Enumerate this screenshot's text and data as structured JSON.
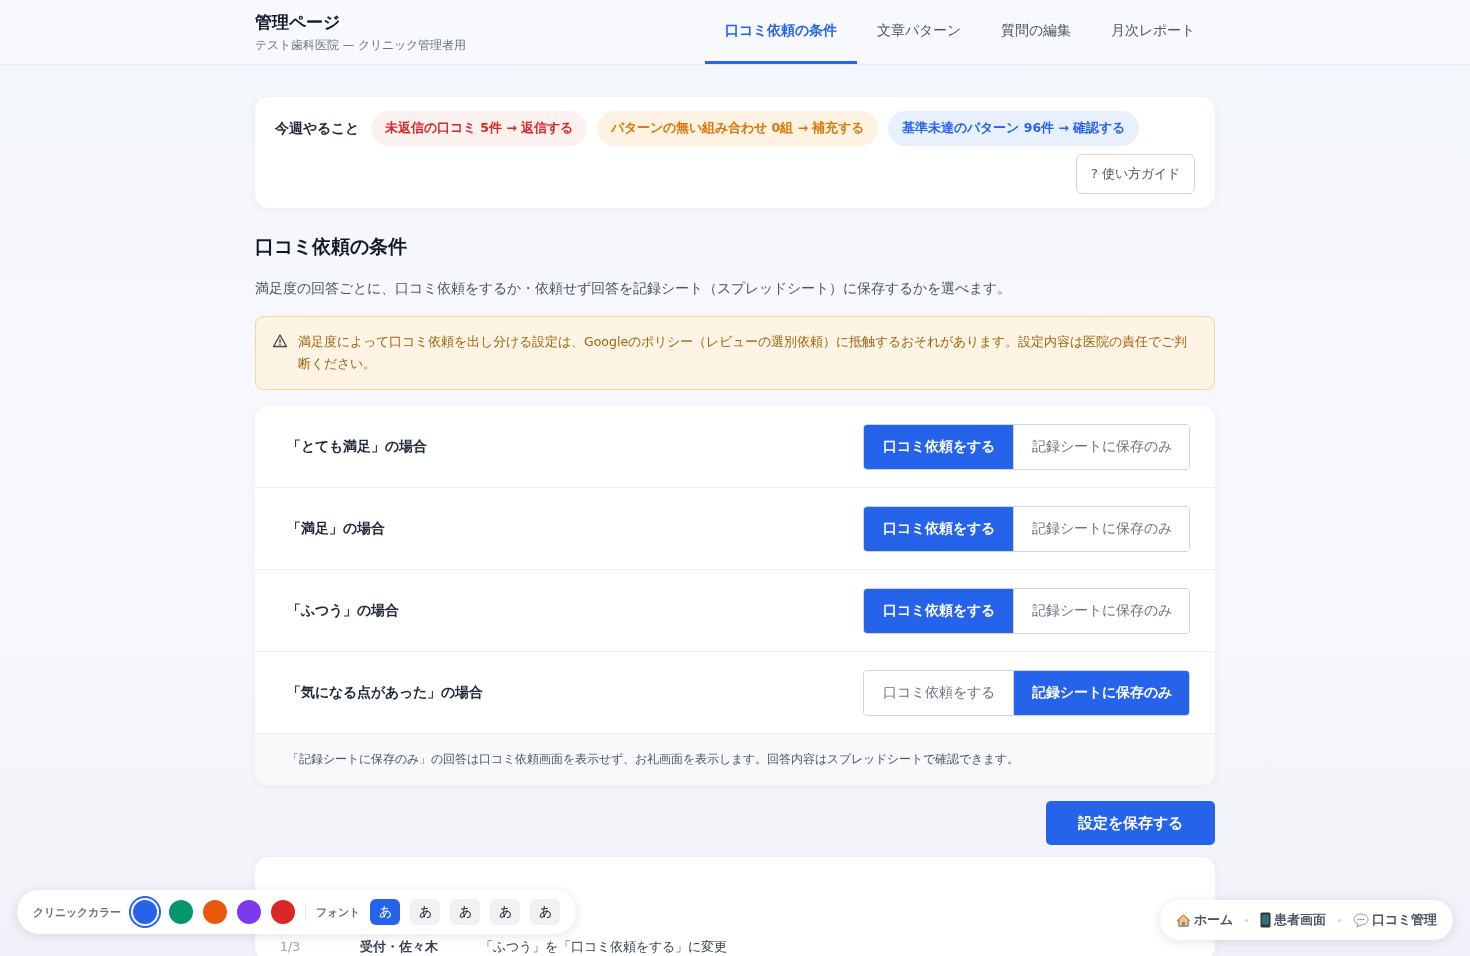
{
  "header": {
    "title": "管理ページ",
    "subtitle": "テスト歯科医院 — クリニック管理者用",
    "tabs": [
      {
        "label": "口コミ依頼の条件",
        "selected": true
      },
      {
        "label": "文章パターン",
        "selected": false
      },
      {
        "label": "質問の編集",
        "selected": false
      },
      {
        "label": "月次レポート",
        "selected": false
      }
    ]
  },
  "todo": {
    "label": "今週やること",
    "chips": [
      {
        "label": "未返信の口コミ 5件 → 返信する",
        "kind": "danger"
      },
      {
        "label": "パターンの無い組み合わせ 0組 → 補充する",
        "kind": "warning"
      },
      {
        "label": "基準未達のパターン 96件 → 確認する",
        "kind": "info"
      }
    ],
    "guide_button": "? 使い方ガイド"
  },
  "section": {
    "title": "口コミ依頼の条件",
    "description": "満足度の回答ごとに、口コミ依頼をするか・依頼せず回答を記録シート（スプレッドシート）に保存するかを選べます。",
    "warning": "満足度によって口コミ依頼を出し分ける設定は、Googleのポリシー（レビューの選別依頼）に抵触するおそれがあります。設定内容は医院の責任でご判断ください。"
  },
  "conditions": [
    {
      "label": "「とても満足」の場合",
      "options": [
        {
          "label": "口コミ依頼をする",
          "selected": true
        },
        {
          "label": "記録シートに保存のみ",
          "selected": false
        }
      ]
    },
    {
      "label": "「満足」の場合",
      "options": [
        {
          "label": "口コミ依頼をする",
          "selected": true
        },
        {
          "label": "記録シートに保存のみ",
          "selected": false
        }
      ]
    },
    {
      "label": "「ふつう」の場合",
      "options": [
        {
          "label": "口コミ依頼をする",
          "selected": true
        },
        {
          "label": "記録シートに保存のみ",
          "selected": false
        }
      ]
    },
    {
      "label": "「気になる点があった」の場合",
      "options": [
        {
          "label": "口コミ依頼をする",
          "selected": false
        },
        {
          "label": "記録シートに保存のみ",
          "selected": true
        }
      ]
    }
  ],
  "conditions_note": "「記録シートに保存のみ」の回答は口コミ依頼画面を表示せず、お礼画面を表示します。回答内容はスプレッドシートで確認できます。",
  "save_button": "設定を保存する",
  "history": [
    {
      "date": "1/3",
      "user": "受付・佐々木",
      "change": "「ふつう」を「口コミ依頼をする」に変更"
    }
  ],
  "palette": {
    "color_label": "クリニックカラー",
    "colors": [
      {
        "color": "#2563eb",
        "selected": true
      },
      {
        "color": "#059669",
        "selected": false
      },
      {
        "color": "#ea580c",
        "selected": false
      },
      {
        "color": "#7c3aed",
        "selected": false
      },
      {
        "color": "#dc2626",
        "selected": false
      }
    ],
    "font_label": "フォント",
    "fonts": [
      {
        "sample": "あ",
        "selected": true
      },
      {
        "sample": "あ",
        "selected": false
      },
      {
        "sample": "あ",
        "selected": false
      },
      {
        "sample": "あ",
        "selected": false
      },
      {
        "sample": "あ",
        "selected": false
      }
    ]
  },
  "quick_links": [
    {
      "kind": "home",
      "label": "ホーム"
    },
    {
      "kind": "phone",
      "label": "患者画面"
    },
    {
      "kind": "chat",
      "label": "口コミ管理"
    }
  ]
}
